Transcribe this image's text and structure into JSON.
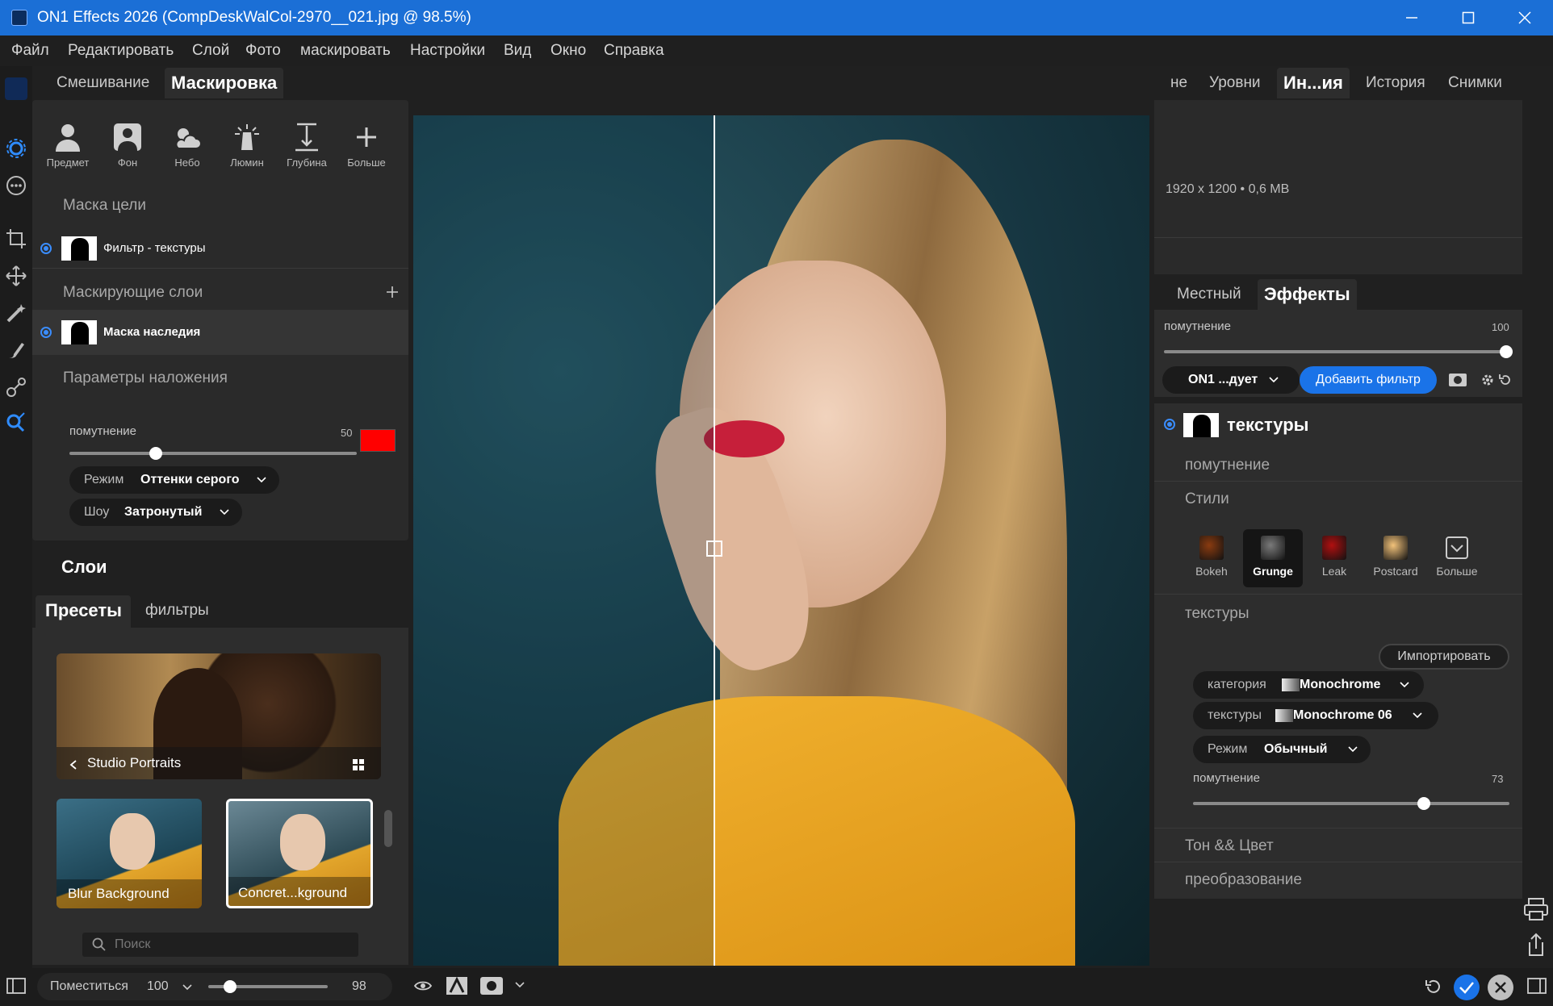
{
  "window": {
    "title": "ON1 Effects 2026 (CompDeskWalCol-2970__021.jpg @ 98.5%)"
  },
  "menu": [
    "Файл",
    "Редактировать",
    "Слой",
    "Фото",
    "маскировать",
    "Настройки",
    "Вид",
    "Окно",
    "Справка"
  ],
  "left_tabs": {
    "blend": "Смешивание",
    "mask": "Маскировка"
  },
  "mask_tools": [
    {
      "label": "Предмет",
      "icon": "person-icon"
    },
    {
      "label": "Фон",
      "icon": "background-icon"
    },
    {
      "label": "Небо",
      "icon": "sky-icon"
    },
    {
      "label": "Люмин",
      "icon": "luminosity-icon"
    },
    {
      "label": "Глубина",
      "icon": "depth-icon"
    },
    {
      "label": "Больше",
      "icon": "plus-icon"
    }
  ],
  "target_mask": {
    "header": "Маска цели",
    "item": "Фильтр - текстуры"
  },
  "masking_layers": {
    "header": "Маскирующие слои",
    "item": "Маска наследия"
  },
  "overlay": {
    "header": "Параметры наложения",
    "opacity_label": "помутнение",
    "opacity_value": "50",
    "opacity_fraction": 0.3,
    "color": "#ff0000",
    "mode_label": "Режим",
    "mode_value": "Оттенки серого",
    "show_label": "Шоу",
    "show_value": "Затронутый"
  },
  "layers_header": "Слои",
  "browser_tabs": {
    "presets": "Пресеты",
    "filters": "фильтры"
  },
  "presets": {
    "category": "Studio Portraits",
    "items": [
      "Blur Background",
      "Concret...kground"
    ]
  },
  "search": {
    "placeholder": "Поиск"
  },
  "right_tabs": [
    "не",
    "Уровни",
    "Ин...ия",
    "История",
    "Снимки"
  ],
  "info": {
    "dimensions": "1920 x 1200",
    "size": "0,6 MB",
    "separator": "•"
  },
  "effects_tabs": {
    "local": "Местный",
    "effects": "Эффекты"
  },
  "master_opacity": {
    "label": "помутнение",
    "value": "100",
    "fraction": 1.0
  },
  "filter_toolbar": {
    "preset_dropdown": "ON1 ...дует",
    "add_filter": "Добавить фильтр"
  },
  "filter": {
    "name": "текстуры",
    "opacity_section": "помутнение",
    "styles_section": "Стили",
    "styles": [
      {
        "label": "Bokeh",
        "selected": false,
        "color": "#8a3b10"
      },
      {
        "label": "Grunge",
        "selected": true,
        "color": "#7a7a7a"
      },
      {
        "label": "Leak",
        "selected": false,
        "color": "#b01010"
      },
      {
        "label": "Postcard",
        "selected": false,
        "color": "#f2c27a"
      },
      {
        "label": "Больше",
        "selected": false,
        "color": ""
      }
    ],
    "textures_section": "текстуры",
    "import_button": "Импортировать",
    "category_label": "категория",
    "category_value": "Monochrome",
    "texture_label": "текстуры",
    "texture_value": "Monochrome 06",
    "mode_label": "Режим",
    "mode_value": "Обычный",
    "opacity_label": "помутнение",
    "opacity_value": "73",
    "opacity_fraction": 0.73,
    "tone_section": "Тон && Цвет",
    "transform_section": "преобразование"
  },
  "statusbar": {
    "fit_label": "Поместиться",
    "zoom_value": "100",
    "zoom_slider_value": "98",
    "zoom_fraction": 0.18
  }
}
